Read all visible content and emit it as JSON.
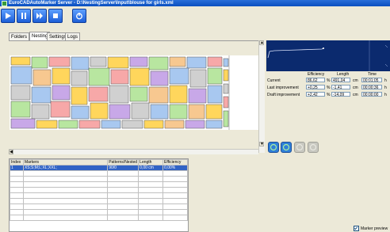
{
  "window": {
    "title": "EuroCADAutoMarker Server - D:\\NestingServer\\Input\\blouse for girls.xml"
  },
  "toolbar": {
    "buttons": [
      "play-icon",
      "pause-icon",
      "fast-forward-icon",
      "stop-icon",
      "power-icon"
    ]
  },
  "tabs": [
    {
      "label": "Folders",
      "active": false
    },
    {
      "label": "Nesting",
      "active": true
    },
    {
      "label": "Settings",
      "active": false
    },
    {
      "label": "Logs",
      "active": false
    }
  ],
  "stats": {
    "headers": {
      "efficiency": "Efficiency",
      "length": "Length",
      "time": "Time"
    },
    "rows": [
      {
        "label": "Current",
        "efficiency": "86,62",
        "eff_unit": "%",
        "length": "491,04",
        "len_unit": "cm",
        "time": "00:01:05",
        "time_unit": "h"
      },
      {
        "label": "Last improvement",
        "efficiency": "+0,25",
        "eff_unit": "%",
        "length": "-1,41",
        "len_unit": "cm",
        "time": "00:00:36",
        "time_unit": "h"
      },
      {
        "label": "Draft improvement",
        "efficiency": "+2,42",
        "eff_unit": "%",
        "length": "-14,09",
        "len_unit": "cm",
        "time": "00:00:00",
        "time_unit": "h"
      }
    ]
  },
  "grid": {
    "columns": [
      "Index",
      "Markers",
      "Patterns/Nested",
      "Length",
      "Efficiency"
    ],
    "rows": [
      [
        "1",
        "XS;S;M;L;XL;XXL;",
        "90/0",
        "0,00 cm",
        "0,00%"
      ]
    ]
  },
  "preview": {
    "label": "Marker preview",
    "checked": true
  },
  "colors": {
    "accent": "#1d5fd8",
    "graph_bg": "#0b2a6e",
    "selection": "#3163c5"
  }
}
